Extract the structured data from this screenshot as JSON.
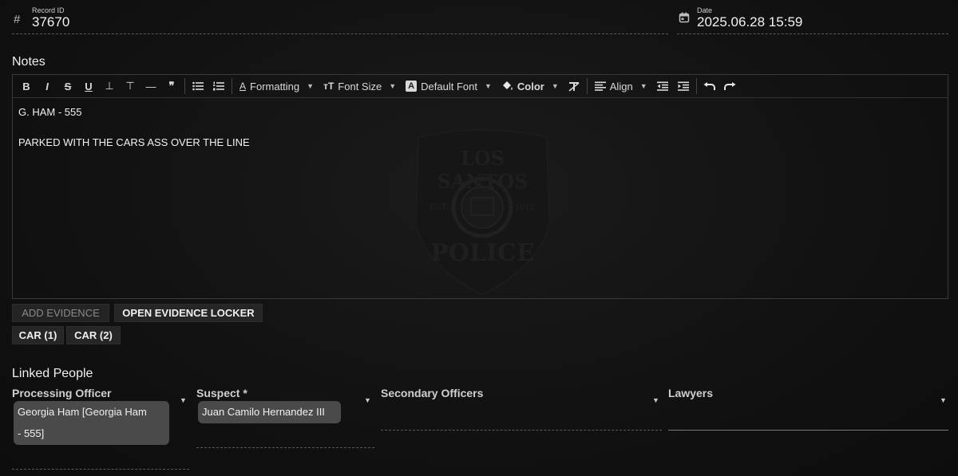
{
  "record": {
    "label": "Record ID",
    "value": "37670",
    "icon": "hash-icon"
  },
  "date": {
    "label": "Date",
    "value": "2025.06.28 15:59",
    "icon": "calendar-icon"
  },
  "notes": {
    "title": "Notes",
    "toolbar": {
      "bold": "B",
      "italic": "I",
      "strike": "S",
      "underline": "U",
      "subscript": "⊥",
      "superscript": "⊤",
      "hr": "—",
      "quote": "❞",
      "formatting": "Formatting",
      "font_size": "Font Size",
      "default_font": "Default Font",
      "font_badge": "A",
      "color": "Color",
      "align": "Align"
    },
    "content": {
      "line1": "G. HAM - 555",
      "line2": "PARKED WITH THE CARS ASS OVER THE LINE"
    },
    "watermark": {
      "top": "LOS SANTOS",
      "est": "EST.",
      "year": "1912",
      "bottom": "POLICE"
    }
  },
  "evidence": {
    "add_label": "ADD EVIDENCE",
    "open_label": "OPEN EVIDENCE LOCKER",
    "items": [
      "CAR (1)",
      "CAR (2)"
    ]
  },
  "linked_people": {
    "title": "Linked People",
    "processing_officer": {
      "label": "Processing Officer",
      "chip_line1": "Georgia Ham [Georgia Ham",
      "chip_line2": "- 555]"
    },
    "suspect": {
      "label": "Suspect *",
      "chip": "Juan Camilo Hernandez III"
    },
    "secondary_officers": {
      "label": "Secondary Officers"
    },
    "lawyers": {
      "label": "Lawyers"
    }
  },
  "colors": {
    "background": "#121212",
    "chip": "#4a4a4a",
    "button": "#262626"
  }
}
